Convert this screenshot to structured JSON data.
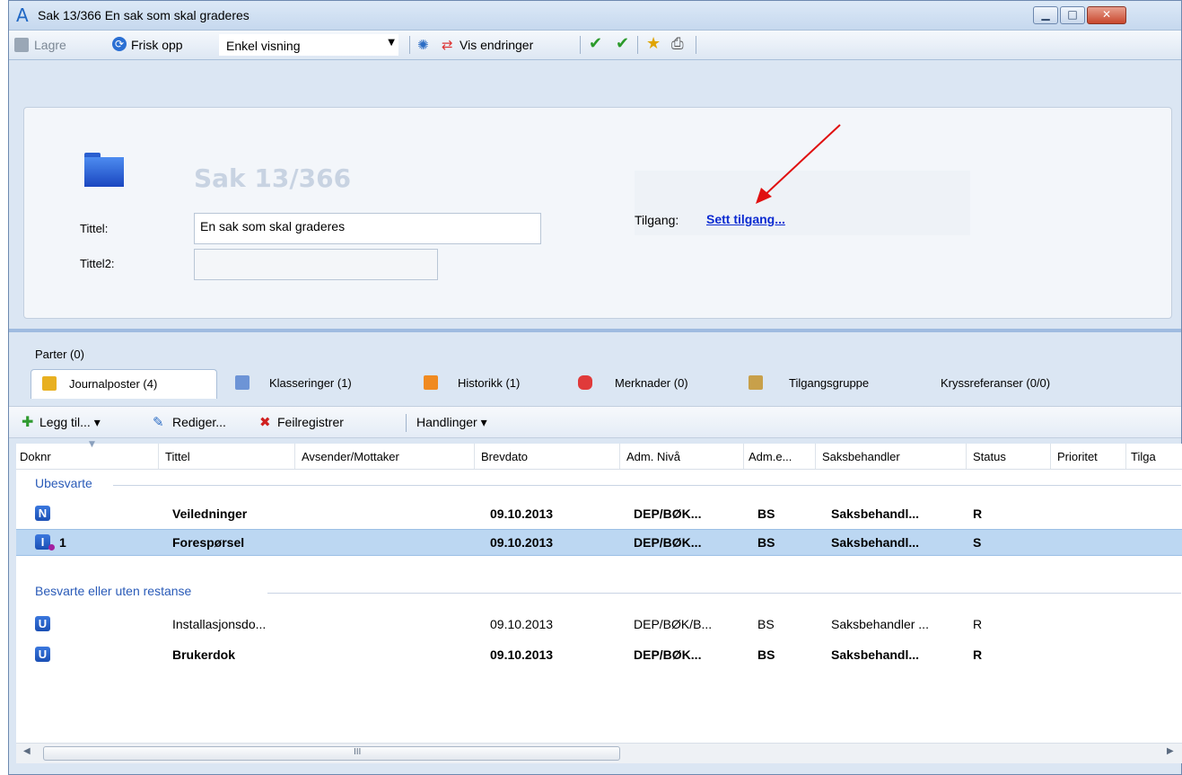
{
  "window": {
    "app_icon": "A",
    "title": "Sak 13/366 En sak som skal graderes",
    "controls": [
      "minimize-icon",
      "maximize-icon",
      "close-icon"
    ]
  },
  "toolbar": {
    "save_label": "Lagre",
    "refresh_label": "Frisk opp",
    "view_combo_value": "Enkel visning",
    "show_changes_label": "Vis endringer"
  },
  "header": {
    "case_title": "Sak 13/366",
    "title_label": "Tittel:",
    "title_value": "En sak som skal graderes",
    "title2_label": "Tittel2:",
    "title2_value": "",
    "access_label": "Tilgang:",
    "access_link": "Sett tilgang..."
  },
  "tabs": {
    "parter_label": "Parter (0)",
    "items": [
      {
        "label": "Journalposter (4)"
      },
      {
        "label": "Klasseringer (1)"
      },
      {
        "label": "Historikk (1)"
      },
      {
        "label": "Merknader (0)"
      },
      {
        "label": "Tilgangsgruppe"
      },
      {
        "label": "Kryssreferanser (0/0)"
      }
    ]
  },
  "gridbar": {
    "add_label": "Legg til...",
    "edit_label": "Rediger...",
    "error_label": "Feilregistrer",
    "actions_label": "Handlinger"
  },
  "grid": {
    "columns": [
      "Doknr",
      "Tittel",
      "Avsender/Mottaker",
      "Brevdato",
      "Adm. Nivå",
      "Adm.e...",
      "Saksbehandler",
      "Status",
      "Prioritet",
      "Tilga"
    ],
    "groups": [
      {
        "label": "Ubesvarte",
        "rows": [
          {
            "badge": "N",
            "doknr": "",
            "tittel": "Veiledninger",
            "avsender": "",
            "brevdato": "09.10.2013",
            "adm_niva": "DEP/BØK...",
            "adm_e": "BS",
            "saksbehandler": "Saksbehandl...",
            "status": "R"
          },
          {
            "badge": "I",
            "doknr": "1",
            "tittel": "Forespørsel",
            "avsender": "",
            "brevdato": "09.10.2013",
            "adm_niva": "DEP/BØK...",
            "adm_e": "BS",
            "saksbehandler": "Saksbehandl...",
            "status": "S"
          }
        ]
      },
      {
        "label": "Besvarte eller uten restanse",
        "rows": [
          {
            "badge": "U",
            "doknr": "",
            "tittel": "Installasjonsdo...",
            "avsender": "",
            "brevdato": "09.10.2013",
            "adm_niva": "DEP/BØK/B...",
            "adm_e": "BS",
            "saksbehandler": "Saksbehandler ...",
            "status": "R"
          },
          {
            "badge": "U",
            "doknr": "",
            "tittel": "Brukerdok",
            "avsender": "",
            "brevdato": "09.10.2013",
            "adm_niva": "DEP/BØK...",
            "adm_e": "BS",
            "saksbehandler": "Saksbehandl...",
            "status": "R"
          }
        ]
      }
    ],
    "scroll_grip": "III"
  }
}
